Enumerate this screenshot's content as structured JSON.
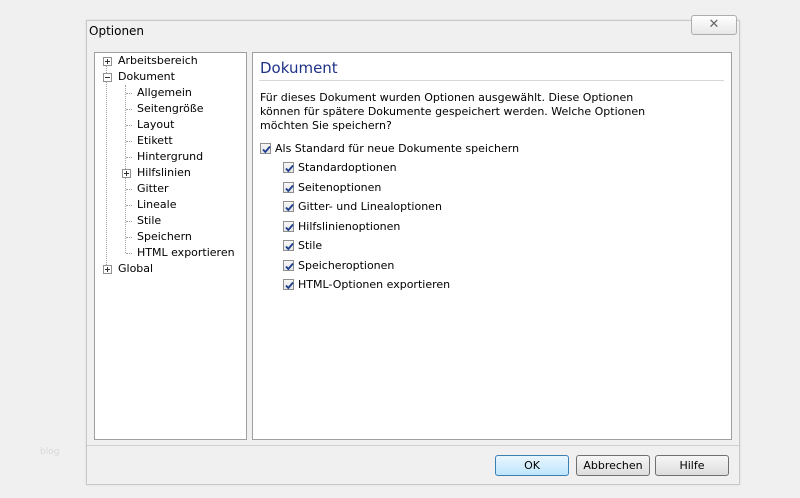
{
  "window": {
    "title": "Optionen",
    "close_glyph": "✕"
  },
  "tree": {
    "items": [
      {
        "label": "Arbeitsbereich",
        "expander": "plus"
      },
      {
        "label": "Dokument",
        "expander": "minus"
      },
      {
        "label": "Allgemein"
      },
      {
        "label": "Seitengröße"
      },
      {
        "label": "Layout"
      },
      {
        "label": "Etikett"
      },
      {
        "label": "Hintergrund"
      },
      {
        "label": "Hilfslinien",
        "expander": "plus"
      },
      {
        "label": "Gitter"
      },
      {
        "label": "Lineale"
      },
      {
        "label": "Stile"
      },
      {
        "label": "Speichern"
      },
      {
        "label": "HTML exportieren"
      },
      {
        "label": "Global",
        "expander": "plus"
      }
    ]
  },
  "panel": {
    "title": "Dokument",
    "description": "Für dieses Dokument wurden Optionen ausgewählt. Diese Optionen können für spätere Dokumente gespeichert werden. Welche Optionen möchten Sie speichern?",
    "main_checkbox": {
      "label": "Als Standard für neue Dokumente speichern",
      "checked": true
    },
    "sub_checkboxes": [
      {
        "label": "Standardoptionen",
        "checked": true
      },
      {
        "label": "Seitenoptionen",
        "checked": true
      },
      {
        "label": "Gitter- und Linealoptionen",
        "checked": true
      },
      {
        "label": "Hilfslinienoptionen",
        "checked": true
      },
      {
        "label": "Stile",
        "checked": true
      },
      {
        "label": "Speicheroptionen",
        "checked": true
      },
      {
        "label": "HTML-Optionen exportieren",
        "checked": true
      }
    ]
  },
  "buttons": {
    "ok": "OK",
    "cancel": "Abbrechen",
    "help": "Hilfe"
  },
  "watermark": "blog",
  "colors": {
    "title_blue": "#1e3287",
    "check_blue": "#1c3e8c"
  }
}
